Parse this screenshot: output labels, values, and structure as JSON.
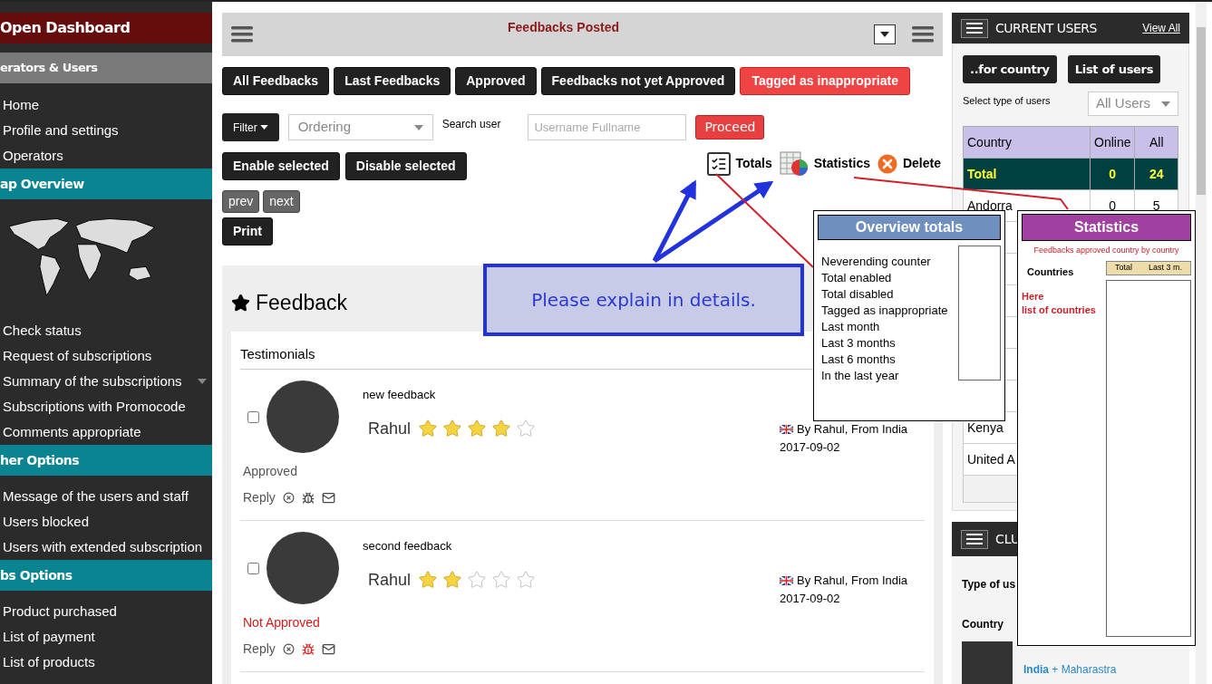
{
  "sidebar": {
    "items": [
      {
        "kind": "brand",
        "label": "Open Dashboard"
      },
      {
        "kind": "group",
        "label": "erators & Users"
      },
      {
        "kind": "link",
        "label": "Home",
        "submenu": false
      },
      {
        "kind": "link",
        "label": "Profile and settings",
        "submenu": false
      },
      {
        "kind": "link",
        "label": "Operators",
        "submenu": false
      },
      {
        "kind": "section",
        "label": "ap Overview"
      },
      {
        "kind": "map"
      },
      {
        "kind": "link",
        "label": "Check status",
        "submenu": false
      },
      {
        "kind": "link",
        "label": "Request of subscriptions",
        "submenu": false
      },
      {
        "kind": "link",
        "label": "Summary of the subscriptions",
        "submenu": true
      },
      {
        "kind": "link",
        "label": "Subscriptions with Promocode",
        "submenu": false
      },
      {
        "kind": "link",
        "label": "Comments appropriate",
        "submenu": false
      },
      {
        "kind": "section",
        "label": "her Options"
      },
      {
        "kind": "link",
        "label": "Message of the users and staff",
        "submenu": false
      },
      {
        "kind": "link",
        "label": "Users blocked",
        "submenu": false
      },
      {
        "kind": "link",
        "label": "Users with extended subscription",
        "submenu": false
      },
      {
        "kind": "section",
        "label": "bs Options"
      },
      {
        "kind": "link",
        "label": "Product purchased",
        "submenu": false
      },
      {
        "kind": "link",
        "label": "List of payment",
        "submenu": false
      },
      {
        "kind": "link",
        "label": "List of products",
        "submenu": false
      }
    ]
  },
  "main": {
    "title": "Feedbacks Posted",
    "tabs": [
      {
        "label": "All Feedbacks",
        "selected": false
      },
      {
        "label": "Last Feedbacks",
        "selected": false
      },
      {
        "label": "Approved",
        "selected": false
      },
      {
        "label": "Feedbacks not yet Approved",
        "selected": false
      },
      {
        "label": "Tagged as inappropriate",
        "selected": true
      }
    ],
    "filter_button": "Filter",
    "ordering": {
      "value": "Ordering"
    },
    "search_label": "Search user",
    "search": {
      "placeholder": "Username Fullname"
    },
    "proceed_button": "Proceed",
    "bulk_buttons": [
      "Enable selected",
      "Disable selected"
    ],
    "tools": [
      {
        "kind": "totals",
        "label": "Totals"
      },
      {
        "kind": "statistics",
        "label": "Statistics"
      },
      {
        "kind": "delete",
        "label": "Delete"
      }
    ],
    "pager": [
      "prev",
      "next"
    ],
    "print_button": "Print",
    "section_title": "Feedback",
    "card_title": "Testimonials",
    "feedbacks": [
      {
        "checked": false,
        "title": "new feedback",
        "name": "Rahul",
        "stars": 4,
        "byline": "By Rahul, From India",
        "date": "2017-09-02",
        "status": "Approved",
        "approved": true,
        "reply": "Reply"
      },
      {
        "checked": false,
        "title": "second feedback",
        "name": "Rahul",
        "stars": 2,
        "byline": "By Rahul, From India",
        "date": "2017-09-02",
        "status": "Not Approved",
        "approved": false,
        "reply": "Reply"
      }
    ]
  },
  "current_users": {
    "title": "CURRENT USERS",
    "view_all": "View All",
    "buttons": [
      "..for country",
      "List of users"
    ],
    "select_label": "Select type of users",
    "select_value": "All Users",
    "columns": [
      "Country",
      "Online",
      "All"
    ],
    "total": {
      "country": "Total",
      "online": "0",
      "all": "24"
    },
    "rows": [
      {
        "country": "Andorra",
        "online": "0",
        "all": "5"
      },
      {
        "country": "Kenya"
      },
      {
        "country": "United A"
      }
    ]
  },
  "clubs": {
    "title": "CLU",
    "type_label": "Type of us",
    "country_label": "Country",
    "country": "India",
    "region": "+ Maharastra"
  },
  "annotations": {
    "callout": "Please explain in details.",
    "overview": {
      "title": "Overview totals",
      "lines": [
        "Neverending counter",
        "Total enabled",
        "Total disabled",
        "Tagged as inappropriate",
        "Last month",
        "Last 3 months",
        "Last 6 months",
        "In the last year"
      ]
    },
    "statistics": {
      "title": "Statistics",
      "subtitle": "Feedbacks approved country by country",
      "countries_label": "Countries",
      "columns": [
        "Total",
        "Last 3 m."
      ],
      "note_lines": [
        "Here",
        "list of countries"
      ]
    }
  }
}
